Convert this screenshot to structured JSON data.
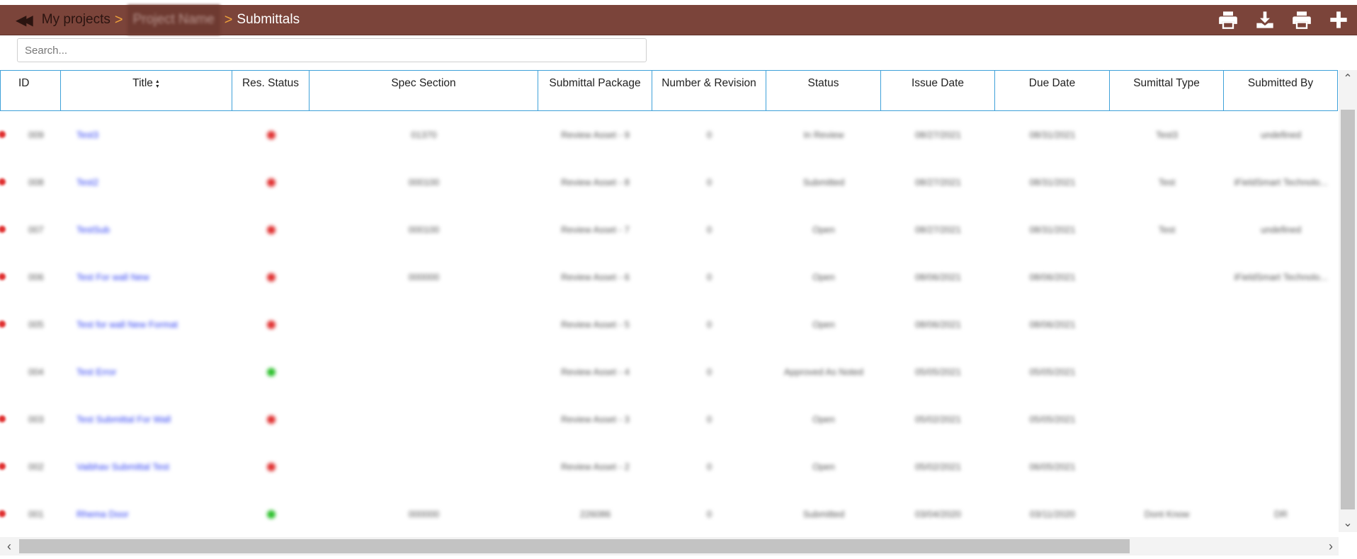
{
  "header": {
    "back_label": "My projects",
    "project_name": "Project Name",
    "current": "Submittals",
    "separator": ">",
    "icons": [
      "print-icon",
      "download-icon",
      "print-icon",
      "plus-icon"
    ]
  },
  "search": {
    "placeholder": "Search...",
    "value": ""
  },
  "table": {
    "columns": [
      "ID",
      "Title",
      "Res. Status",
      "Spec Section",
      "Submittal Package",
      "Number & Revision",
      "Status",
      "Issue Date",
      "Due Date",
      "Sumittal Type",
      "Submitted By"
    ],
    "rows": [
      {
        "id": "009",
        "title": "Test3",
        "res_status": "red",
        "spec": "01370",
        "package": "Review Asset - 9",
        "number": "0",
        "status": "In Review",
        "issue": "08/27/2021",
        "due": "08/31/2021",
        "type": "Test3",
        "by": "undefined",
        "marked": true
      },
      {
        "id": "008",
        "title": "Test2",
        "res_status": "red",
        "spec": "000100",
        "package": "Review Asset - 8",
        "number": "0",
        "status": "Submitted",
        "issue": "08/27/2021",
        "due": "08/31/2021",
        "type": "Test",
        "by": "iFieldSmart Technolo...",
        "marked": true
      },
      {
        "id": "007",
        "title": "TestSub",
        "res_status": "red",
        "spec": "000100",
        "package": "Review Asset - 7",
        "number": "0",
        "status": "Open",
        "issue": "08/27/2021",
        "due": "08/31/2021",
        "type": "Test",
        "by": "undefined",
        "marked": true
      },
      {
        "id": "006",
        "title": "Test For wall New",
        "res_status": "red",
        "spec": "000000",
        "package": "Review Asset - 6",
        "number": "0",
        "status": "Open",
        "issue": "08/06/2021",
        "due": "08/06/2021",
        "type": "",
        "by": "iFieldSmart Technolo...",
        "marked": true
      },
      {
        "id": "005",
        "title": "Test for wall New Format",
        "res_status": "red",
        "spec": "",
        "package": "Review Asset - 5",
        "number": "0",
        "status": "Open",
        "issue": "08/06/2021",
        "due": "08/06/2021",
        "type": "",
        "by": "",
        "marked": true
      },
      {
        "id": "004",
        "title": "Test Error",
        "res_status": "green",
        "spec": "",
        "package": "Review Asset - 4",
        "number": "0",
        "status": "Approved As Noted",
        "issue": "05/05/2021",
        "due": "05/05/2021",
        "type": "",
        "by": "",
        "marked": false
      },
      {
        "id": "003",
        "title": "Test Submittal For Wall",
        "res_status": "red",
        "spec": "",
        "package": "Review Asset - 3",
        "number": "0",
        "status": "Open",
        "issue": "05/02/2021",
        "due": "05/05/2021",
        "type": "",
        "by": "",
        "marked": true
      },
      {
        "id": "002",
        "title": "Vaibhav Submittal Test",
        "res_status": "red",
        "spec": "",
        "package": "Review Asset - 2",
        "number": "0",
        "status": "Open",
        "issue": "05/02/2021",
        "due": "06/05/2021",
        "type": "",
        "by": "",
        "marked": true
      },
      {
        "id": "001",
        "title": "Rhema Door",
        "res_status": "green",
        "spec": "000000",
        "package": "226086",
        "number": "0",
        "status": "Submitted",
        "issue": "03/04/2020",
        "due": "03/11/2020",
        "type": "Dont Know",
        "by": "DR",
        "marked": true
      }
    ]
  },
  "colors": {
    "header_bg": "#7b443a",
    "separator": "#f2a43a",
    "border": "#3fa1d9",
    "link": "#2b3cf2",
    "red": "#e03030",
    "green": "#2cc02c"
  }
}
